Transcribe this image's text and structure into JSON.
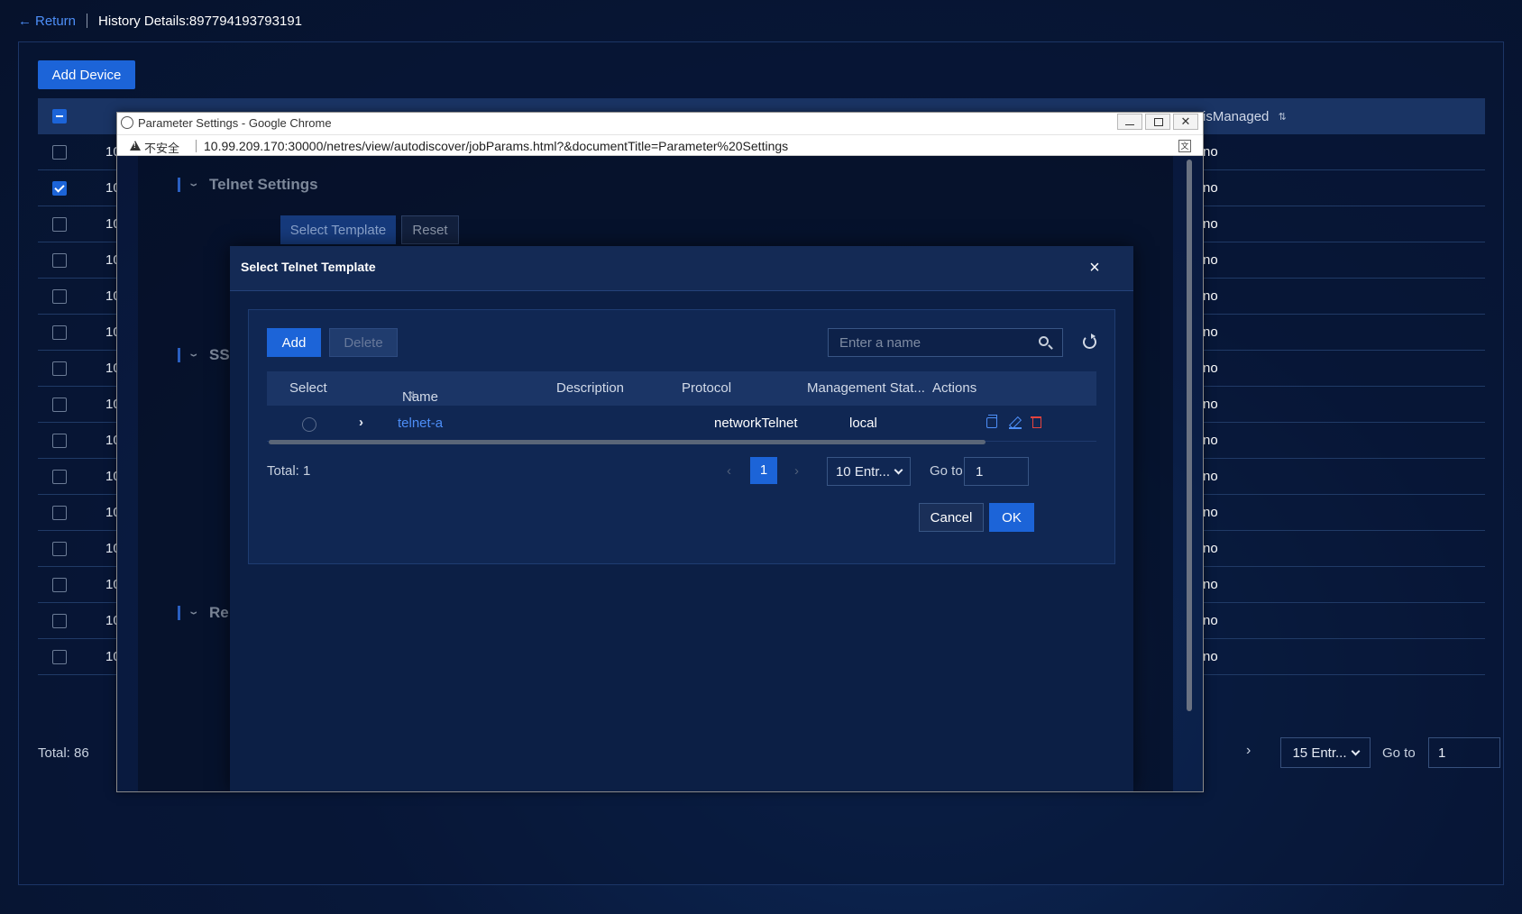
{
  "header": {
    "return_label": "Return",
    "title": "History Details:897794193793191"
  },
  "devices": {
    "add_device_label": "Add Device",
    "is_managed_header": "isManaged",
    "rows": [
      {
        "ip": "10",
        "checked": false,
        "is_managed": "no"
      },
      {
        "ip": "10",
        "checked": true,
        "is_managed": "no"
      },
      {
        "ip": "10",
        "checked": false,
        "is_managed": "no"
      },
      {
        "ip": "10",
        "checked": false,
        "is_managed": "no"
      },
      {
        "ip": "10",
        "checked": false,
        "is_managed": "no"
      },
      {
        "ip": "10",
        "checked": false,
        "is_managed": "no"
      },
      {
        "ip": "10",
        "checked": false,
        "is_managed": "no"
      },
      {
        "ip": "10",
        "checked": false,
        "is_managed": "no"
      },
      {
        "ip": "10",
        "checked": false,
        "is_managed": "no"
      },
      {
        "ip": "10",
        "checked": false,
        "is_managed": "no"
      },
      {
        "ip": "10",
        "checked": false,
        "is_managed": "no"
      },
      {
        "ip": "10",
        "checked": false,
        "is_managed": "no"
      },
      {
        "ip": "10",
        "checked": false,
        "is_managed": "no"
      },
      {
        "ip": "10",
        "checked": false,
        "is_managed": "no"
      },
      {
        "ip": "10",
        "checked": false,
        "is_managed": "no"
      }
    ],
    "total": "Total: 86",
    "page_size": "15 Entr...",
    "goto_label": "Go to",
    "goto_value": "1"
  },
  "chrome": {
    "window_title": "Parameter Settings - Google Chrome",
    "insecure_label": "不安全",
    "url": "10.99.209.170:30000/netres/view/autodiscover/jobParams.html?&documentTitle=Parameter%20Settings"
  },
  "params": {
    "telnet_section": "Telnet Settings",
    "ssh_section": "SS",
    "re_section": "Re",
    "select_template_label": "Select Template",
    "reset_label": "Reset"
  },
  "modal": {
    "title": "Select Telnet Template",
    "add_label": "Add",
    "delete_label": "Delete",
    "search_placeholder": "Enter a name",
    "columns": {
      "select": "Select",
      "name": "Name",
      "description": "Description",
      "protocol": "Protocol",
      "management": "Management Stat...",
      "actions": "Actions"
    },
    "rows": [
      {
        "name": "telnet-a",
        "description": "",
        "protocol": "networkTelnet",
        "management": "local"
      }
    ],
    "total": "Total: 1",
    "current_page": "1",
    "page_size": "10 Entr...",
    "goto_label": "Go to",
    "goto_value": "1",
    "cancel_label": "Cancel",
    "ok_label": "OK"
  },
  "colors": {
    "accent": "#1c64d8",
    "link": "#4d8ef7",
    "danger": "#e5433e",
    "background": "#08183a"
  }
}
